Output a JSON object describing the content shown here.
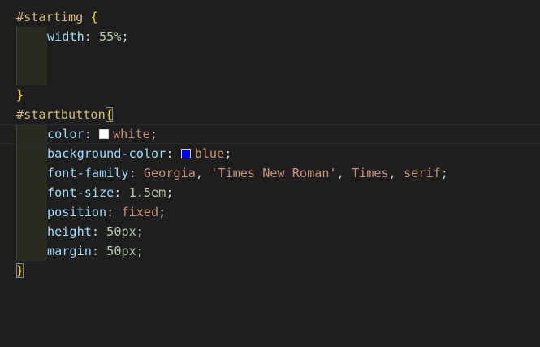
{
  "code": {
    "l1_selector": "#startimg",
    "l1_brace": " {",
    "l2_prop": "width",
    "l2_value": "55%",
    "l5_brace": "}",
    "l6_selector": "#startbutton",
    "l6_brace": "{",
    "l7_prop": "color",
    "l7_value": "white",
    "l8_prop": "background-color",
    "l8_value": "blue",
    "l9_prop": "font-family",
    "l9_v1": "Georgia",
    "l9_v2": "'Times New Roman'",
    "l9_v3": "Times",
    "l9_v4": "serif",
    "l10_prop": "font-size",
    "l10_value": "1.5em",
    "l11_prop": "position",
    "l11_value": "fixed",
    "l12_prop": "height",
    "l12_value": "50px",
    "l13_prop": "margin",
    "l13_value": "50px",
    "l14_brace": "}"
  },
  "colors": {
    "white_swatch": "#ffffff",
    "blue_swatch": "#0000ff"
  }
}
